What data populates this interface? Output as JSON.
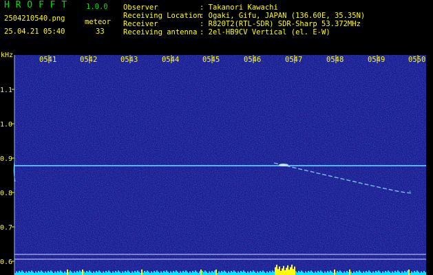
{
  "app": {
    "title": "H R O F F T",
    "version": "1.0.0"
  },
  "file": {
    "name": "2504210540.png",
    "datetime": "25.04.21 05:40"
  },
  "detections": {
    "label": "meteor",
    "count": "33"
  },
  "info": {
    "observer_key": "Observer",
    "observer_val": ": Takanori Kawachi",
    "location_key": "Receiving Location",
    "location_val": ": Ogaki, Gifu, JAPAN (136.60E, 35.35N)",
    "receiver_key": "Receiver",
    "receiver_val": ": R820T2(RTL-SDR) SDR-Sharp 53.372MHz",
    "antenna_key": "Receiving antenna",
    "antenna_val": ": 2el-HB9CV Vertical (el. E-W)"
  },
  "axis": {
    "unit": "kHz",
    "y_ticks": [
      "1.1",
      "1.0",
      "0.9",
      "0.8",
      "0.7",
      "0.6"
    ],
    "x_ticks": [
      "0541",
      "0542",
      "0543",
      "0544",
      "0545",
      "0546",
      "0547",
      "0548",
      "0549",
      "0550"
    ]
  },
  "colors": {
    "background": "#1a1a8c",
    "carrier": "#5fd0ff",
    "level_bar": "#00e8ff",
    "level_peak": "#ffff00",
    "title": "#00e000",
    "label": "#ffff00"
  }
}
